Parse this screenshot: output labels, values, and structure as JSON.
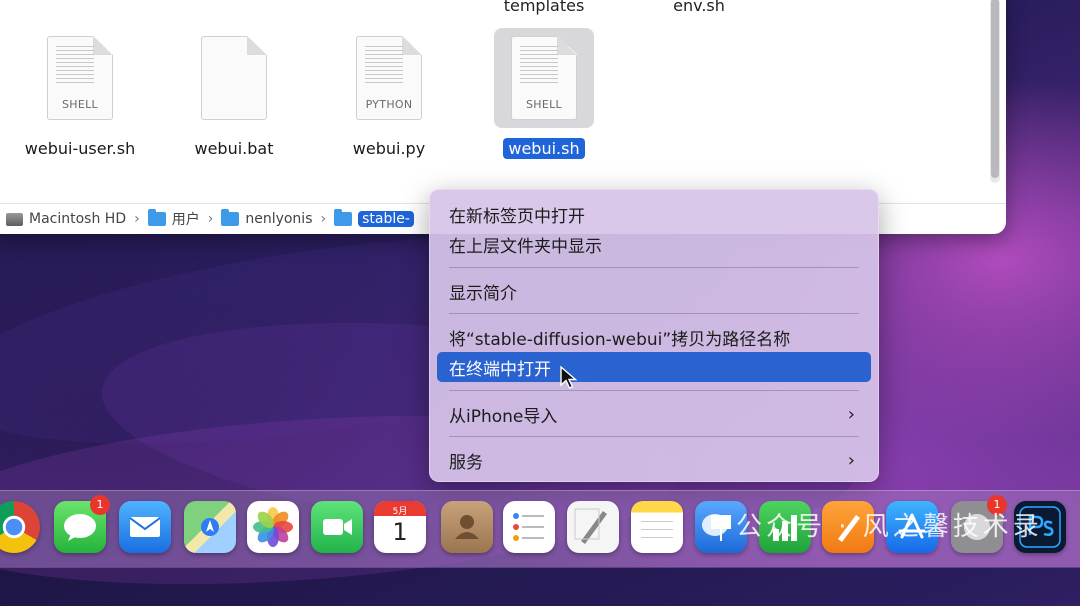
{
  "finder": {
    "top_labels": [
      "templates",
      "env.sh"
    ],
    "files": [
      {
        "name": "webui-user.sh",
        "kind": "SHELL",
        "lined": true,
        "selected": false
      },
      {
        "name": "webui.bat",
        "kind": "",
        "lined": false,
        "selected": false
      },
      {
        "name": "webui.py",
        "kind": "PYTHON",
        "lined": true,
        "selected": false
      },
      {
        "name": "webui.sh",
        "kind": "SHELL",
        "lined": true,
        "selected": true
      }
    ],
    "path": [
      "Macintosh HD",
      "用户",
      "nenlyonis",
      "stable-"
    ],
    "path_icons": [
      "disk-icon",
      "folder-icon",
      "home-folder-icon",
      "folder-icon"
    ]
  },
  "context_menu": {
    "items": [
      {
        "label": "在新标签页中打开",
        "highlighted": false,
        "submenu": false
      },
      {
        "label": "在上层文件夹中显示",
        "highlighted": false,
        "submenu": false
      },
      {
        "label": "显示简介",
        "highlighted": false,
        "submenu": false
      },
      {
        "label": "将“stable-diffusion-webui”拷贝为路径名称",
        "highlighted": false,
        "submenu": false
      },
      {
        "label": "在终端中打开",
        "highlighted": true,
        "submenu": false
      },
      {
        "label": "从iPhone导入",
        "highlighted": false,
        "submenu": true
      },
      {
        "label": "服务",
        "highlighted": false,
        "submenu": true
      }
    ],
    "highlight_color": "#2a62d0"
  },
  "dock": {
    "apps": [
      {
        "name": "chrome-icon",
        "badge": ""
      },
      {
        "name": "messages-icon",
        "badge": "1"
      },
      {
        "name": "mail-icon",
        "badge": ""
      },
      {
        "name": "maps-icon",
        "badge": ""
      },
      {
        "name": "photos-icon",
        "badge": ""
      },
      {
        "name": "facetime-icon",
        "badge": ""
      },
      {
        "name": "calendar-icon",
        "badge": ""
      },
      {
        "name": "contacts-icon",
        "badge": ""
      },
      {
        "name": "reminders-icon",
        "badge": ""
      },
      {
        "name": "freeform-icon",
        "badge": ""
      },
      {
        "name": "notes-icon",
        "badge": ""
      },
      {
        "name": "keynote-icon",
        "badge": ""
      },
      {
        "name": "numbers-icon",
        "badge": ""
      },
      {
        "name": "pages-icon",
        "badge": ""
      },
      {
        "name": "app-store-icon",
        "badge": ""
      },
      {
        "name": "system-settings-icon",
        "badge": "1"
      },
      {
        "name": "photoshop-icon",
        "badge": ""
      }
    ],
    "calendar": {
      "month": "5月",
      "day": "1"
    }
  },
  "watermark": {
    "text": "公众号 · 风之馨技术录"
  }
}
